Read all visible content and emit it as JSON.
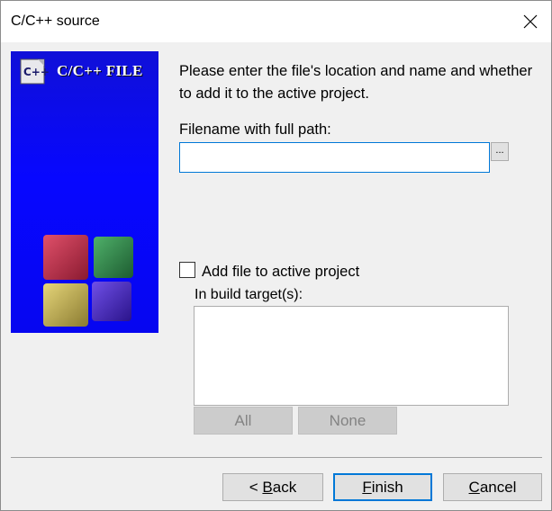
{
  "window": {
    "title": "C/C++ source"
  },
  "banner": {
    "title": "C/C++ FILE",
    "logo_text": "C++"
  },
  "prompt": "Please enter the file's location and name and whether to add it to the active project.",
  "filename": {
    "label": "Filename with full path:",
    "value": "",
    "browse_label": "..."
  },
  "add_to_project": {
    "label": "Add file to active project",
    "checked": false
  },
  "build_targets": {
    "label": "In build target(s):",
    "items": []
  },
  "target_buttons": {
    "all": "All",
    "none": "None"
  },
  "nav": {
    "back_mnemonic": "B",
    "back_prefix": "< ",
    "back_rest": "ack",
    "finish_mnemonic": "F",
    "finish_rest": "inish",
    "cancel_mnemonic": "C",
    "cancel_rest": "ancel"
  },
  "colors": {
    "banner": "#0707ff",
    "accent": "#0078d7",
    "cube_red": "#c0304a",
    "cube_green": "#2e8a4a",
    "cube_yellow": "#c7b24a",
    "cube_purple": "#4b2fbf"
  }
}
